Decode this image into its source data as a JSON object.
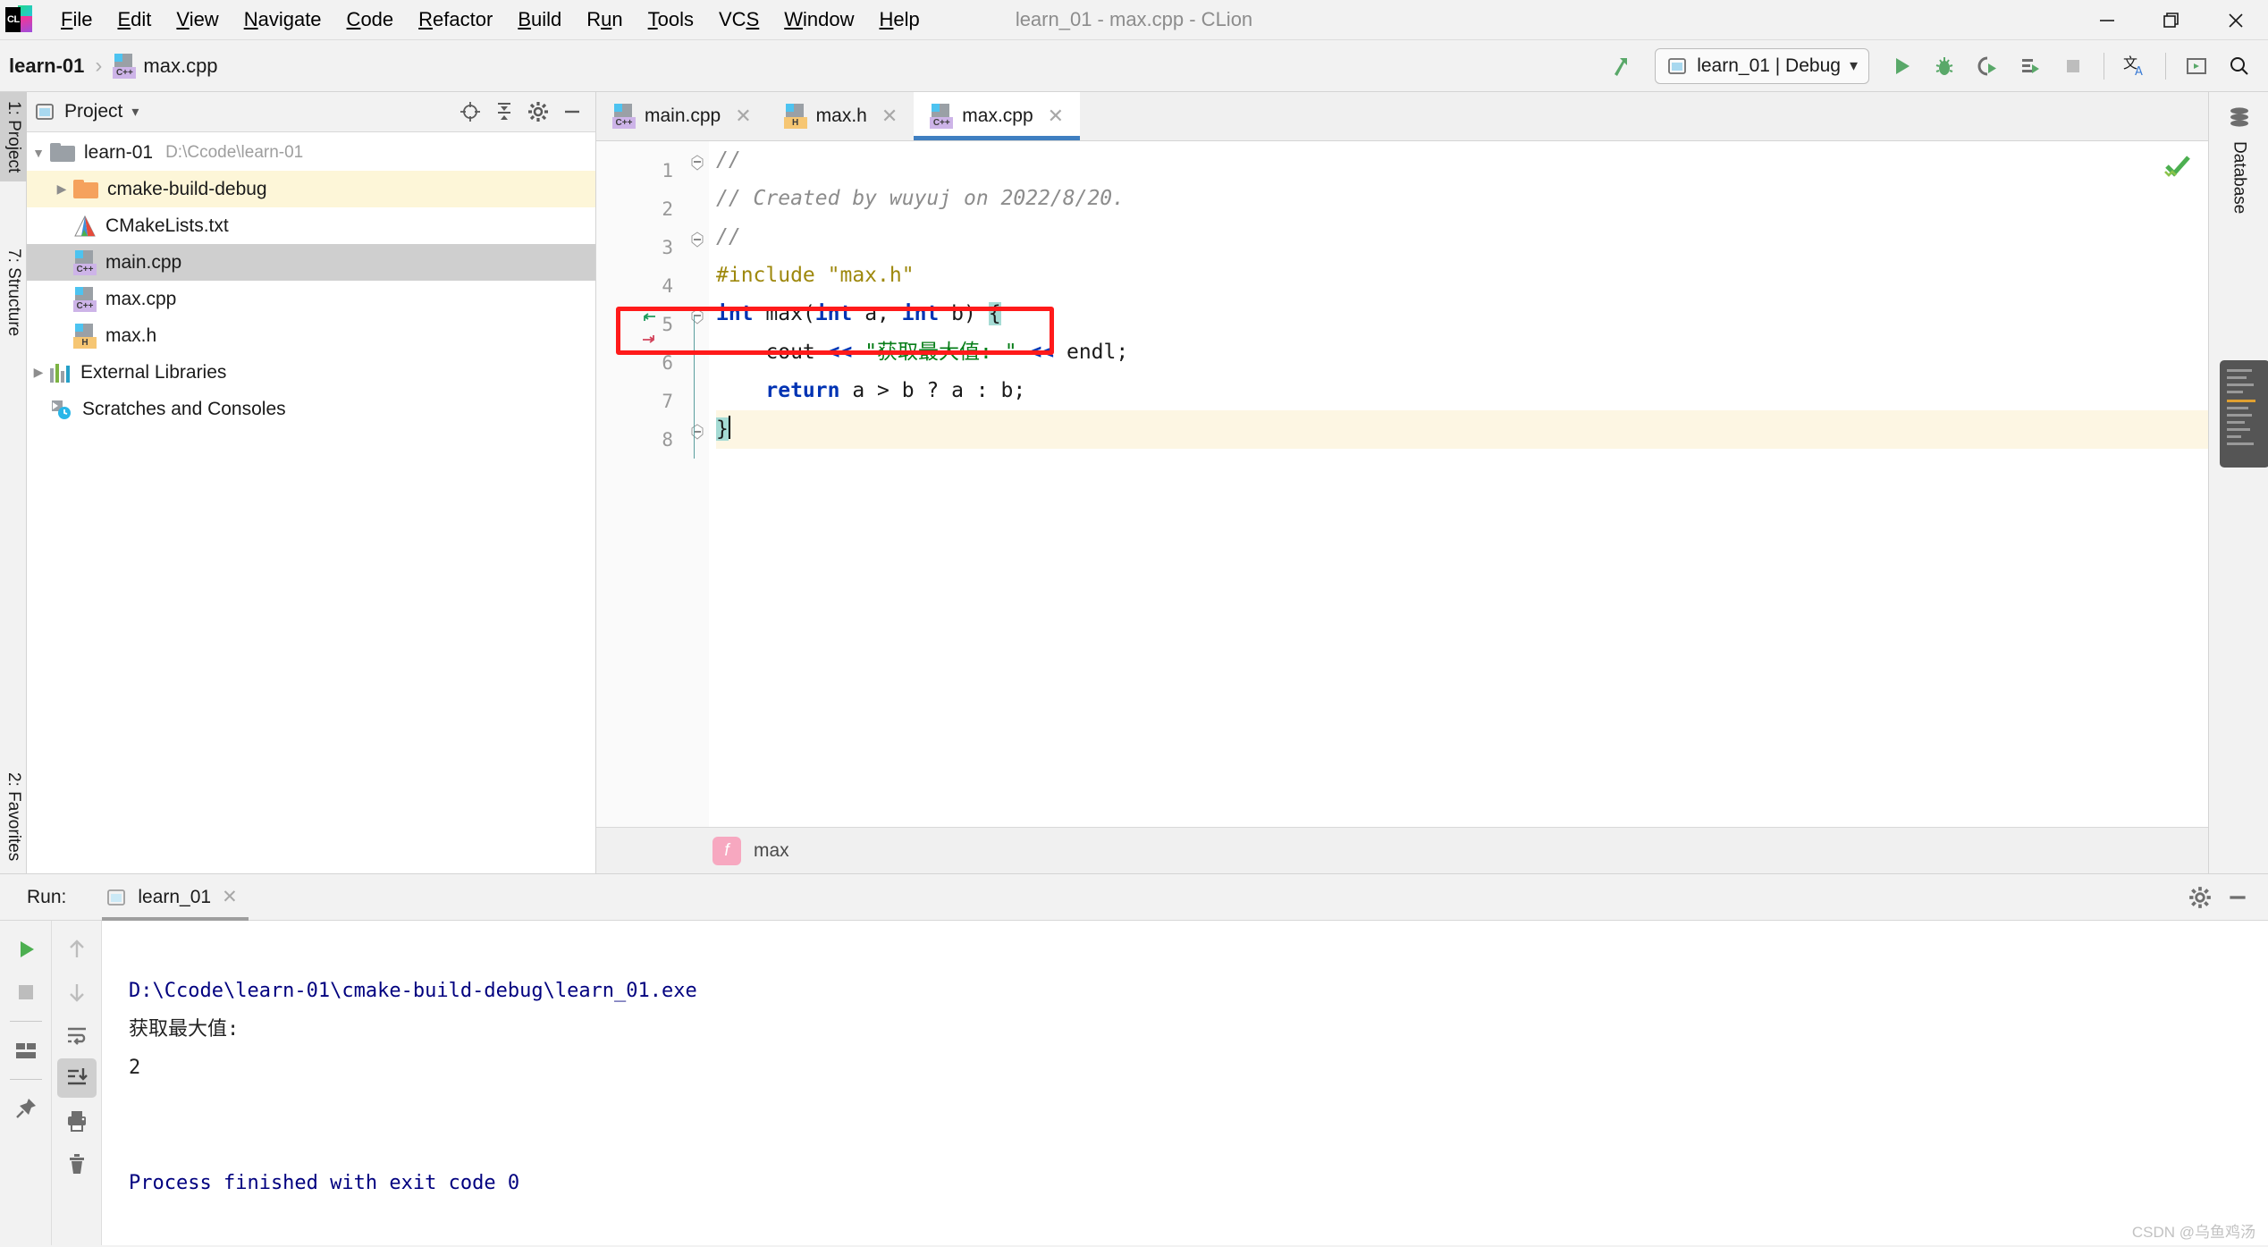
{
  "window": {
    "title": "learn_01 - max.cpp - CLion",
    "minimize": "—",
    "maximize": "❐",
    "close": "✕"
  },
  "menubar": {
    "items": [
      {
        "label": "File",
        "mnemonic": "F"
      },
      {
        "label": "Edit",
        "mnemonic": "E"
      },
      {
        "label": "View",
        "mnemonic": "V"
      },
      {
        "label": "Navigate",
        "mnemonic": "N"
      },
      {
        "label": "Code",
        "mnemonic": "C"
      },
      {
        "label": "Refactor",
        "mnemonic": "R"
      },
      {
        "label": "Build",
        "mnemonic": "B"
      },
      {
        "label": "Run",
        "mnemonic": "u"
      },
      {
        "label": "Tools",
        "mnemonic": "T"
      },
      {
        "label": "VCS",
        "mnemonic": "S"
      },
      {
        "label": "Window",
        "mnemonic": "W"
      },
      {
        "label": "Help",
        "mnemonic": "H"
      }
    ]
  },
  "navbar": {
    "breadcrumbs": [
      {
        "label": "learn-01",
        "icon": "project-icon"
      },
      {
        "label": "max.cpp",
        "icon": "cpp-file-icon"
      }
    ],
    "separator": "›",
    "run_config": {
      "label": "learn_01 | Debug",
      "icon": "run-config-icon",
      "chevron": "▾"
    },
    "actions": [
      {
        "name": "build-hammer-icon"
      },
      {
        "name": "run-icon"
      },
      {
        "name": "debug-icon"
      },
      {
        "name": "run-with-coverage-icon"
      },
      {
        "name": "profile-icon"
      },
      {
        "name": "stop-icon"
      },
      {
        "name": "translate-icon"
      },
      {
        "name": "terminal-icon"
      },
      {
        "name": "search-icon"
      }
    ]
  },
  "left_strip": {
    "tabs": [
      {
        "label": "1: Project",
        "active": true
      },
      {
        "label": "7: Structure",
        "active": false
      },
      {
        "label": "2: Favorites",
        "active": false
      }
    ]
  },
  "right_strip": {
    "tabs": [
      {
        "label": "Database",
        "icon": "database-icon"
      }
    ]
  },
  "project_panel": {
    "title": "Project",
    "chevron": "▾",
    "actions": [
      {
        "name": "locate-icon"
      },
      {
        "name": "collapse-all-icon"
      },
      {
        "name": "settings-gear-icon"
      },
      {
        "name": "hide-icon"
      }
    ],
    "tree": [
      {
        "label": "learn-01",
        "path": "D:\\Ccode\\learn-01",
        "arrow": "▼",
        "icon": "folder-grey",
        "indent": 0,
        "state": "normal"
      },
      {
        "label": "cmake-build-debug",
        "path": "",
        "arrow": "▶",
        "icon": "folder-orange",
        "indent": 1,
        "state": "highlight"
      },
      {
        "label": "CMakeLists.txt",
        "path": "",
        "arrow": "",
        "icon": "cmake-icon",
        "indent": 1,
        "state": "normal"
      },
      {
        "label": "main.cpp",
        "path": "",
        "arrow": "",
        "icon": "cpp-file-icon",
        "indent": 1,
        "state": "selected"
      },
      {
        "label": "max.cpp",
        "path": "",
        "arrow": "",
        "icon": "cpp-file-icon",
        "indent": 1,
        "state": "normal"
      },
      {
        "label": "max.h",
        "path": "",
        "arrow": "",
        "icon": "h-file-icon",
        "indent": 1,
        "state": "normal"
      },
      {
        "label": "External Libraries",
        "path": "",
        "arrow": "▶",
        "icon": "libraries-icon",
        "indent": 0,
        "state": "normal"
      },
      {
        "label": "Scratches and Consoles",
        "path": "",
        "arrow": "",
        "icon": "scratches-icon",
        "indent": 0,
        "state": "normal"
      }
    ]
  },
  "editor": {
    "tabs": [
      {
        "label": "main.cpp",
        "icon": "cpp-file-icon",
        "active": false,
        "close": "✕"
      },
      {
        "label": "max.h",
        "icon": "h-file-icon",
        "active": false,
        "close": "✕"
      },
      {
        "label": "max.cpp",
        "icon": "cpp-file-icon",
        "active": true,
        "close": "✕"
      }
    ],
    "line_numbers": [
      "1",
      "2",
      "3",
      "4",
      "5",
      "6",
      "7",
      "8"
    ],
    "lines": [
      {
        "n": 1,
        "tokens": [
          {
            "t": "//",
            "c": "cm"
          }
        ]
      },
      {
        "n": 2,
        "tokens": [
          {
            "t": "// Created by ",
            "c": "cm"
          },
          {
            "t": "wuyuj",
            "c": "cm typo"
          },
          {
            "t": " on 2022/8/20.",
            "c": "cm"
          }
        ]
      },
      {
        "n": 3,
        "tokens": [
          {
            "t": "//",
            "c": "cm"
          }
        ]
      },
      {
        "n": 4,
        "tokens": [
          {
            "t": "#include ",
            "c": "pre"
          },
          {
            "t": "\"max.h\"",
            "c": "pre"
          }
        ]
      },
      {
        "n": 5,
        "tokens": [
          {
            "t": "int",
            "c": "kw"
          },
          {
            "t": " ",
            "c": "pl"
          },
          {
            "t": "max",
            "c": "fn"
          },
          {
            "t": "(",
            "c": "pl"
          },
          {
            "t": "int",
            "c": "kw"
          },
          {
            "t": " a, ",
            "c": "pl"
          },
          {
            "t": "int",
            "c": "kw"
          },
          {
            "t": " b) ",
            "c": "pl"
          },
          {
            "t": "{",
            "c": "pl sel"
          }
        ]
      },
      {
        "n": 6,
        "tokens": [
          {
            "t": "    cout ",
            "c": "pl"
          },
          {
            "t": "<<",
            "c": "kw"
          },
          {
            "t": " ",
            "c": "pl"
          },
          {
            "t": "\"获取最大值: \"",
            "c": "str"
          },
          {
            "t": " ",
            "c": "pl"
          },
          {
            "t": "<<",
            "c": "kw"
          },
          {
            "t": " endl;",
            "c": "pl"
          }
        ]
      },
      {
        "n": 7,
        "tokens": [
          {
            "t": "    ",
            "c": "pl"
          },
          {
            "t": "return",
            "c": "kw"
          },
          {
            "t": " a > b ? a : b;",
            "c": "pl"
          }
        ]
      },
      {
        "n": 8,
        "tokens": [
          {
            "t": "}",
            "c": "pl sel"
          }
        ]
      }
    ],
    "annotation": {
      "name": "red-highlight-box",
      "line": 5
    },
    "gutter_markers": {
      "line": 5,
      "icons": [
        "override-arrow-left-icon",
        "implement-arrow-right-icon"
      ]
    },
    "inspection_status": "ok-checkmark",
    "breadcrumb": {
      "badge": "f",
      "label": "max"
    }
  },
  "run_panel": {
    "label": "Run:",
    "tab": {
      "label": "learn_01",
      "icon": "run-config-icon",
      "close": "✕"
    },
    "header_actions": [
      {
        "name": "settings-gear-icon"
      },
      {
        "name": "hide-panel-icon"
      }
    ],
    "sidebar_primary": [
      {
        "name": "rerun-icon"
      },
      {
        "name": "stop-icon"
      },
      {
        "name": "layout-icon"
      },
      {
        "name": "pin-tab-icon"
      }
    ],
    "sidebar_secondary": [
      {
        "name": "up-arrow-icon"
      },
      {
        "name": "down-arrow-icon"
      },
      {
        "name": "soft-wrap-icon"
      },
      {
        "name": "scroll-to-end-icon"
      },
      {
        "name": "print-icon"
      },
      {
        "name": "clear-all-icon"
      }
    ],
    "console_lines": [
      {
        "text": "D:\\Ccode\\learn-01\\cmake-build-debug\\learn_01.exe",
        "style": "blue"
      },
      {
        "text": "获取最大值:",
        "style": "dark"
      },
      {
        "text": "2",
        "style": "dark"
      },
      {
        "text": "",
        "style": "dark"
      },
      {
        "text": "",
        "style": "dark"
      },
      {
        "text": "Process finished with exit code 0",
        "style": "blue"
      }
    ]
  },
  "watermark": "CSDN @乌鱼鸡汤",
  "colors": {
    "accent_blue": "#3f7fc1",
    "selection": "#cfcfcf",
    "highlight_row": "#fdf6d8",
    "red_box": "#ff1a1a",
    "console_blue": "#00007f",
    "keyword": "#0033b3",
    "string": "#067d17",
    "comment": "#8c8c8c",
    "preproc": "#9e880d",
    "green_run": "#4caf50"
  }
}
